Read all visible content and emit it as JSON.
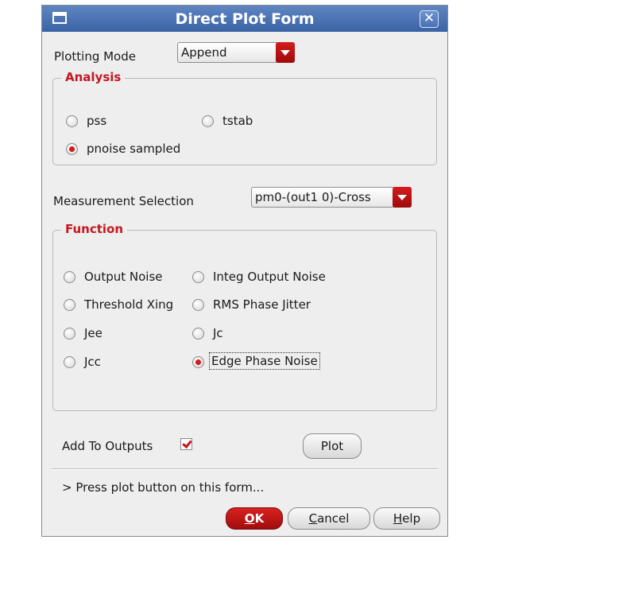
{
  "window": {
    "title": "Direct Plot Form",
    "icon": "window-menu-icon",
    "close_icon": "close-icon",
    "close_glyph": "✕"
  },
  "plotting_mode": {
    "label": "Plotting Mode",
    "value": "Append"
  },
  "analysis": {
    "legend": "Analysis",
    "options": [
      {
        "label": "pss",
        "checked": false
      },
      {
        "label": "tstab",
        "checked": false
      },
      {
        "label": "pnoise sampled",
        "checked": true
      }
    ]
  },
  "measurement": {
    "label": "Measurement Selection",
    "value": "pm0-(out1 0)-Cross"
  },
  "function": {
    "legend": "Function",
    "options": [
      {
        "label": "Output Noise",
        "checked": false
      },
      {
        "label": "Integ Output Noise",
        "checked": false
      },
      {
        "label": "Threshold Xing",
        "checked": false
      },
      {
        "label": "RMS Phase Jitter",
        "checked": false
      },
      {
        "label": "Jee",
        "checked": false
      },
      {
        "label": "Jc",
        "checked": false
      },
      {
        "label": "Jcc",
        "checked": false
      },
      {
        "label": "Edge Phase Noise",
        "checked": true
      }
    ]
  },
  "add_to_outputs": {
    "label": "Add To Outputs",
    "checked": true
  },
  "plot_button": "Plot",
  "status_message": "> Press plot button on this form...",
  "footer": {
    "ok": "OK",
    "cancel": "Cancel",
    "help": "Help"
  },
  "colors": {
    "title_bar": "#4a72b4",
    "accent_red": "#c3181f"
  }
}
